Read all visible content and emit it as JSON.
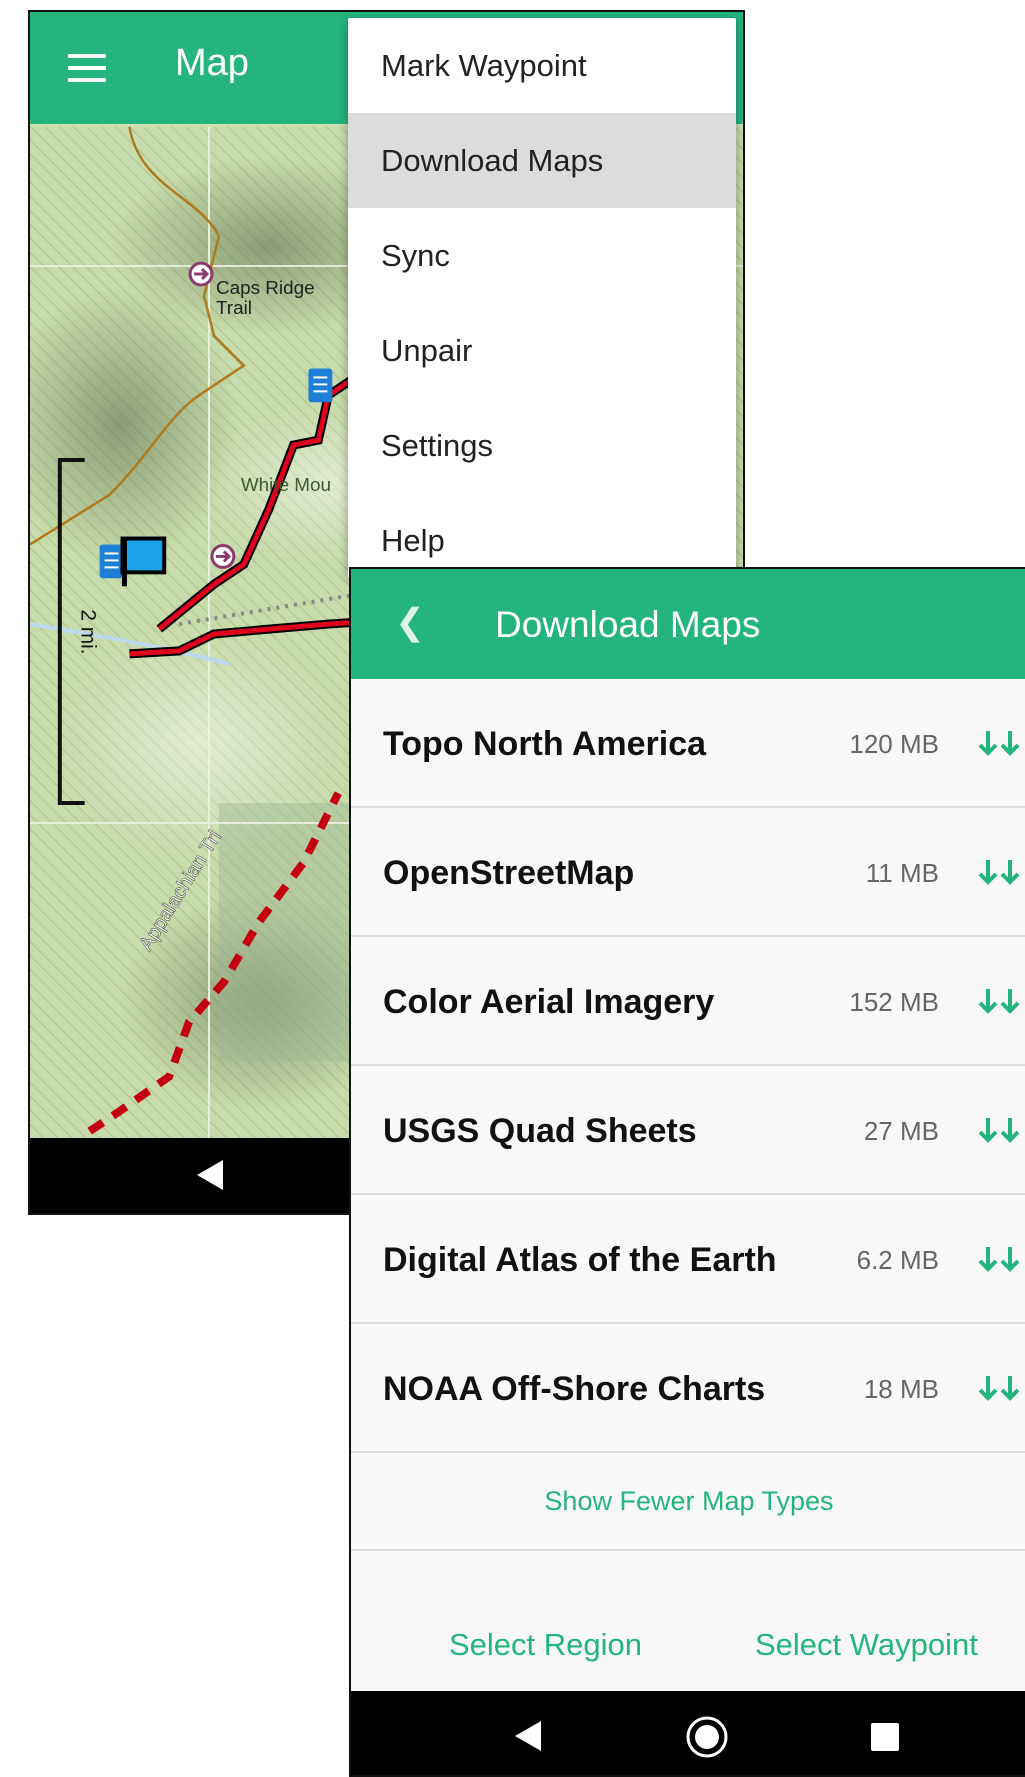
{
  "map_screen": {
    "title": "Map",
    "labels": {
      "caps_ridge": "Caps Ridge",
      "caps_ridge_2": "Trail",
      "white_mountain": "White Mou",
      "appalachian": "Appalachian Trl",
      "scale": "2 mi."
    },
    "menu": [
      {
        "label": "Mark Waypoint"
      },
      {
        "label": "Download Maps"
      },
      {
        "label": "Sync"
      },
      {
        "label": "Unpair"
      },
      {
        "label": "Settings"
      },
      {
        "label": "Help"
      }
    ]
  },
  "download_screen": {
    "title": "Download Maps",
    "back_icon": "chevron-left-icon",
    "map_types": [
      {
        "name": "Topo North America",
        "size": "120 MB"
      },
      {
        "name": "OpenStreetMap",
        "size": "11 MB"
      },
      {
        "name": "Color Aerial Imagery",
        "size": "152 MB"
      },
      {
        "name": "USGS Quad Sheets",
        "size": "27 MB"
      },
      {
        "name": "Digital Atlas of the Earth",
        "size": "6.2 MB"
      },
      {
        "name": "NOAA Off-Shore Charts",
        "size": "18 MB"
      }
    ],
    "show_fewer_label": "Show Fewer Map Types",
    "select_region_label": "Select Region",
    "select_waypoint_label": "Select Waypoint"
  },
  "colors": {
    "accent": "#24b47e",
    "track": "#e0001b",
    "menu_highlight": "#dcdcdc"
  }
}
